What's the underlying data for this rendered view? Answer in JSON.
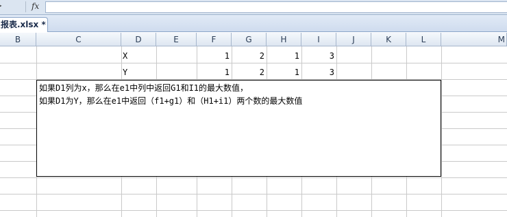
{
  "formula_bar": {
    "fx_label": "fx",
    "formula": ""
  },
  "tab": {
    "label": "报表.xlsx *"
  },
  "columns": [
    "B",
    "C",
    "D",
    "E",
    "F",
    "G",
    "H",
    "I",
    "J",
    "K",
    "L",
    "M"
  ],
  "rows": {
    "x_row": {
      "label": "X",
      "F": "1",
      "G": "2",
      "H": "1",
      "I": "3"
    },
    "y_row": {
      "label": "Y",
      "F": "1",
      "G": "2",
      "H": "1",
      "I": "3"
    }
  },
  "merged_note": {
    "line1": "如果D1列为x，那么在e1中列中返回G1和I1的最大数值，",
    "line2": "如果D1为Y，那么在e1中返回（f1+g1）和（H1+i1）两个数的最大数值"
  }
}
